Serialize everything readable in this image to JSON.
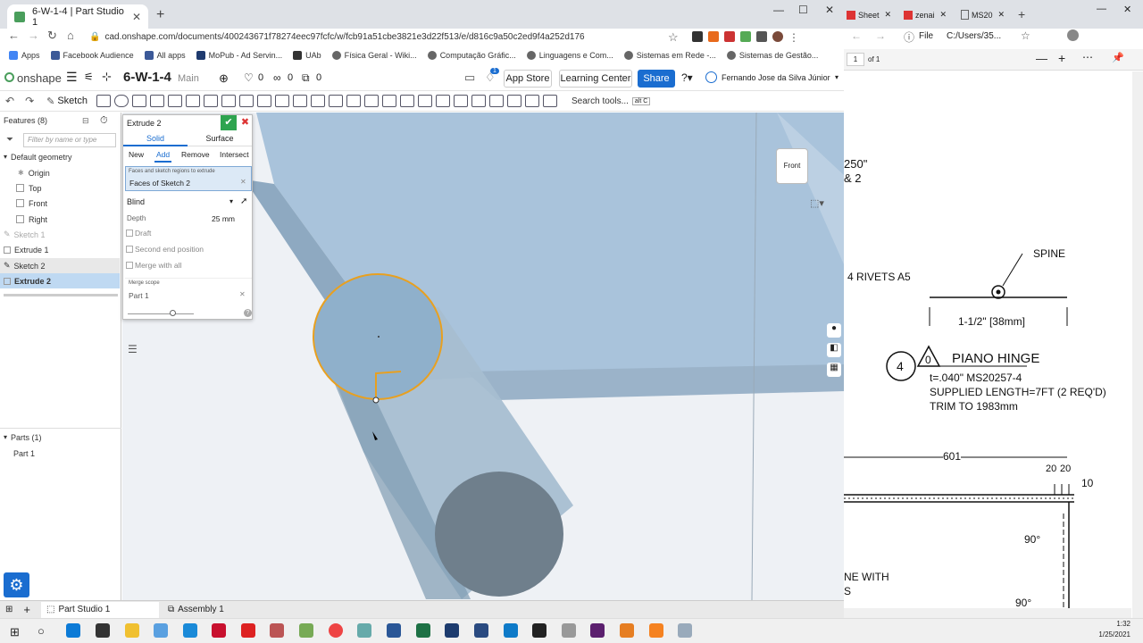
{
  "browser": {
    "tab_title": "6-W-1-4 | Part Studio 1",
    "url": "cad.onshape.com/documents/400243671f78274eec97fcfc/w/fcb91a51cbe3821e3d22f513/e/d816c9a50c2ed9f4a252d176",
    "bookmarks": [
      "Apps",
      "Facebook Audience",
      "All apps",
      "MoPub - Ad Servin...",
      "UAb",
      "Física Geral - Wiki...",
      "Computação Gráfic...",
      "Linguagens e Com...",
      "Sistemas em Rede -...",
      "Sistemas de Gestão..."
    ]
  },
  "header": {
    "logo": "onshape",
    "doc_title": "6-W-1-4",
    "branch": "Main",
    "likes": "0",
    "links": "0",
    "copies": "0",
    "notif_badge": "1",
    "app_store": "App Store",
    "learning_center": "Learning Center",
    "share": "Share",
    "user": "Fernando Jose da Silva Júnior"
  },
  "toolbar": {
    "sketch": "Sketch",
    "search_placeholder": "Search tools...",
    "search_shortcut": "alt C"
  },
  "features": {
    "title": "Features (8)",
    "filter_placeholder": "Filter by name or type",
    "default_geometry": "Default geometry",
    "items": [
      "Origin",
      "Top",
      "Front",
      "Right",
      "Sketch 1",
      "Extrude 1",
      "Sketch 2",
      "Extrude 2"
    ],
    "parts_title": "Parts (1)",
    "parts": [
      "Part 1"
    ]
  },
  "dialog": {
    "title": "Extrude 2",
    "tab_solid": "Solid",
    "tab_surface": "Surface",
    "op_new": "New",
    "op_add": "Add",
    "op_remove": "Remove",
    "op_intersect": "Intersect",
    "faces_label": "Faces and sketch regions to extrude",
    "faces_value": "Faces of Sketch 2",
    "end_type": "Blind",
    "depth_label": "Depth",
    "depth_value": "25 mm",
    "draft": "Draft",
    "second_end": "Second end position",
    "merge_all": "Merge with all",
    "merge_scope_label": "Merge scope",
    "merge_scope_value": "Part 1"
  },
  "viewcube": {
    "face": "Front"
  },
  "bottom_tabs": [
    "Part Studio 1",
    "Assembly 1"
  ],
  "right_browser": {
    "tabs": [
      "Sheet",
      "zenai",
      "MS20"
    ],
    "file_label": "File",
    "path": "C:/Users/35...",
    "page_input": "1",
    "page_total": "of 1"
  },
  "drawing": {
    "t1": "250\"",
    "t2": "& 2",
    "rivets": "4  RIVETS A5",
    "spine": "SPINE",
    "dim1": "1-1/2\" [38mm]",
    "item_num": "4",
    "tri_num": "0",
    "hinge": "PIANO HINGE",
    "spec1": "t=.040\"  MS20257-4",
    "spec2": "SUPPLIED LENGTH=7FT (2 REQ'D)",
    "spec3": "TRIM TO 1983mm",
    "d601": "601",
    "d20": "20",
    "d20b": "20",
    "d10": "10",
    "a90": "90°",
    "a90b": "90°",
    "ne_with": "NE WITH",
    "s": "S"
  },
  "clock": {
    "time": "1:32",
    "date": "1/25/2021"
  }
}
